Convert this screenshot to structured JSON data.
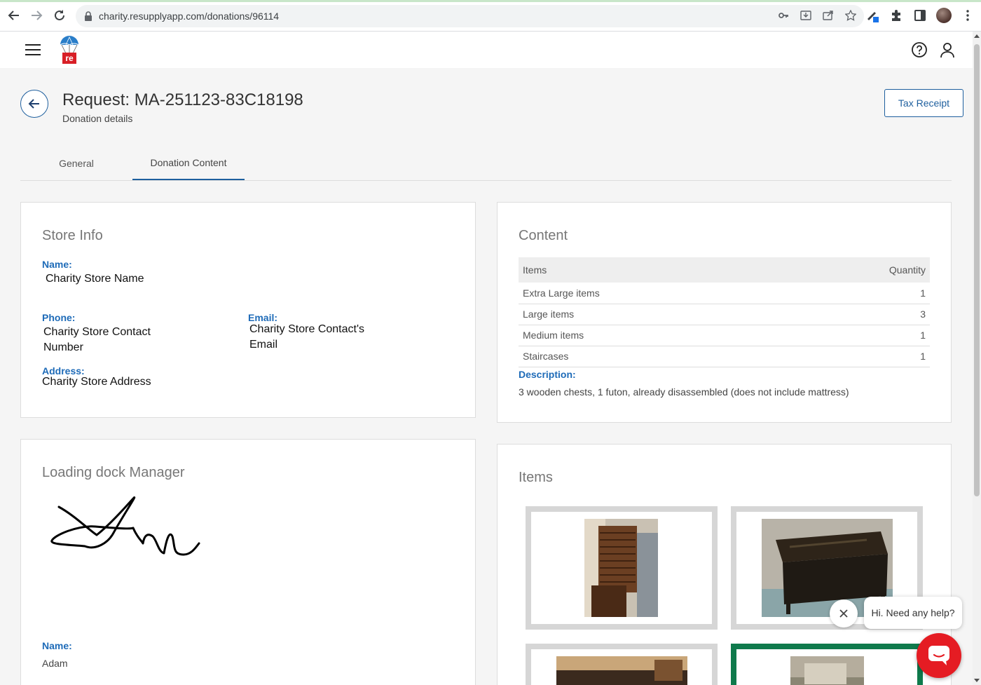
{
  "browser": {
    "url": "charity.resupplyapp.com/donations/96114"
  },
  "header": {
    "logo_text": "re"
  },
  "page": {
    "title": "Request: MA-251123-83C18198",
    "subtitle": "Donation details",
    "tax_receipt_label": "Tax Receipt"
  },
  "tabs": [
    {
      "label": "General"
    },
    {
      "label": "Donation Content"
    }
  ],
  "store_info": {
    "title": "Store Info",
    "name_label": "Name:",
    "name_value": "Charity Store Name",
    "phone_label": "Phone:",
    "phone_value": "Charity Store Contact Number",
    "email_label": "Email:",
    "email_value": "Charity Store Contact's Email",
    "address_label": "Address:",
    "address_value": "Charity Store Address"
  },
  "content": {
    "title": "Content",
    "col_items": "Items",
    "col_quantity": "Quantity",
    "rows": [
      {
        "item": "Extra Large items",
        "qty": "1"
      },
      {
        "item": "Large items",
        "qty": "3"
      },
      {
        "item": "Medium items",
        "qty": "1"
      },
      {
        "item": "Staircases",
        "qty": "1"
      }
    ],
    "description_label": "Description:",
    "description": "3 wooden chests, 1 futon, already disassembled (does not include mattress)"
  },
  "loading_dock": {
    "title": "Loading dock Manager",
    "name_label": "Name:",
    "name_value": "Adam"
  },
  "items": {
    "title": "Items"
  },
  "chat": {
    "bubble_text": "Hi. Need any help?"
  },
  "colors": {
    "primary": "#1e5f9e",
    "label_blue": "#1e6bb8",
    "chat_red": "#e51c23",
    "selected_green": "#0f7a4c"
  }
}
